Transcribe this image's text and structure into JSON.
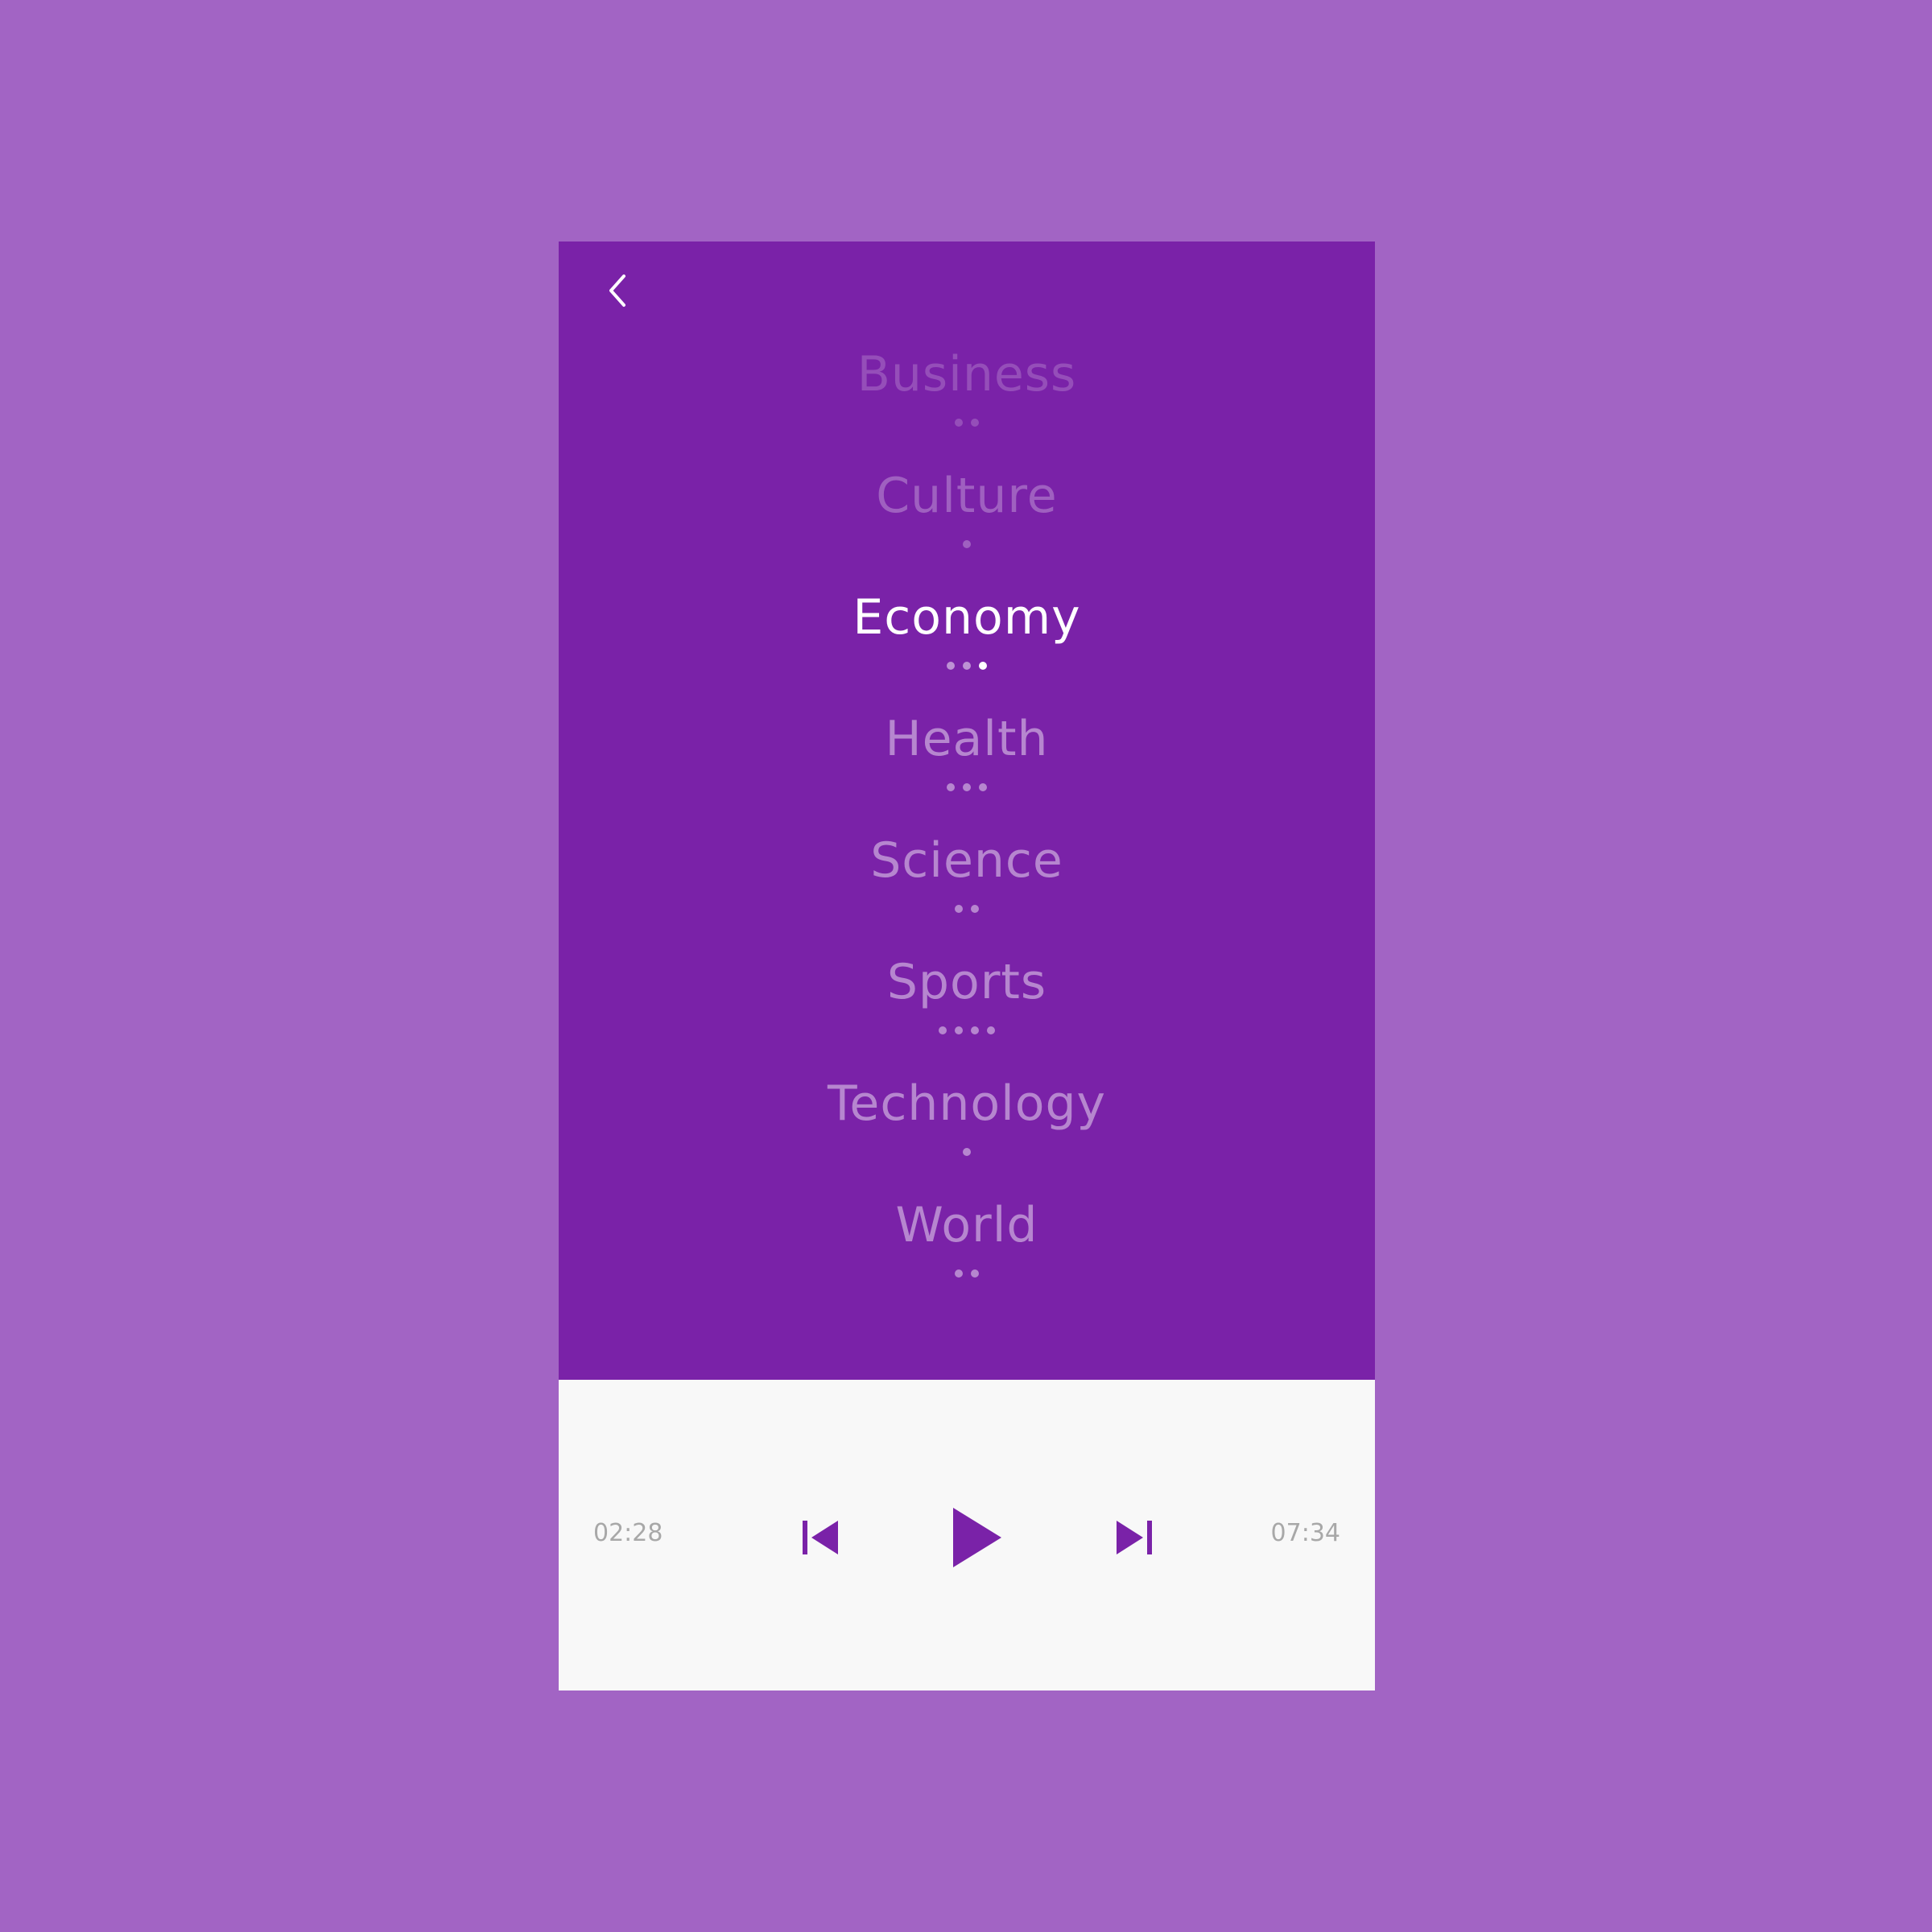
{
  "colors": {
    "background": "#a264c4",
    "panel": "#7a22a8",
    "player_bg": "#f8f8f8",
    "accent": "#7a22a8",
    "time_text": "#a8a8a8"
  },
  "header": {
    "back_icon": "chevron-left-icon"
  },
  "topics": [
    {
      "label": "Business",
      "dots": 2,
      "state": "faint"
    },
    {
      "label": "Culture",
      "dots": 1,
      "state": "faint2"
    },
    {
      "label": "Economy",
      "dots": 3,
      "state": "active",
      "current_dot": 3
    },
    {
      "label": "Health",
      "dots": 3,
      "state": "dim"
    },
    {
      "label": "Science",
      "dots": 2,
      "state": "dim"
    },
    {
      "label": "Sports",
      "dots": 4,
      "state": "dim"
    },
    {
      "label": "Technology",
      "dots": 1,
      "state": "dim"
    },
    {
      "label": "World",
      "dots": 2,
      "state": "dim"
    }
  ],
  "player": {
    "elapsed": "02:28",
    "total": "07:34",
    "prev_icon": "skip-previous-icon",
    "play_icon": "play-icon",
    "next_icon": "skip-next-icon"
  }
}
